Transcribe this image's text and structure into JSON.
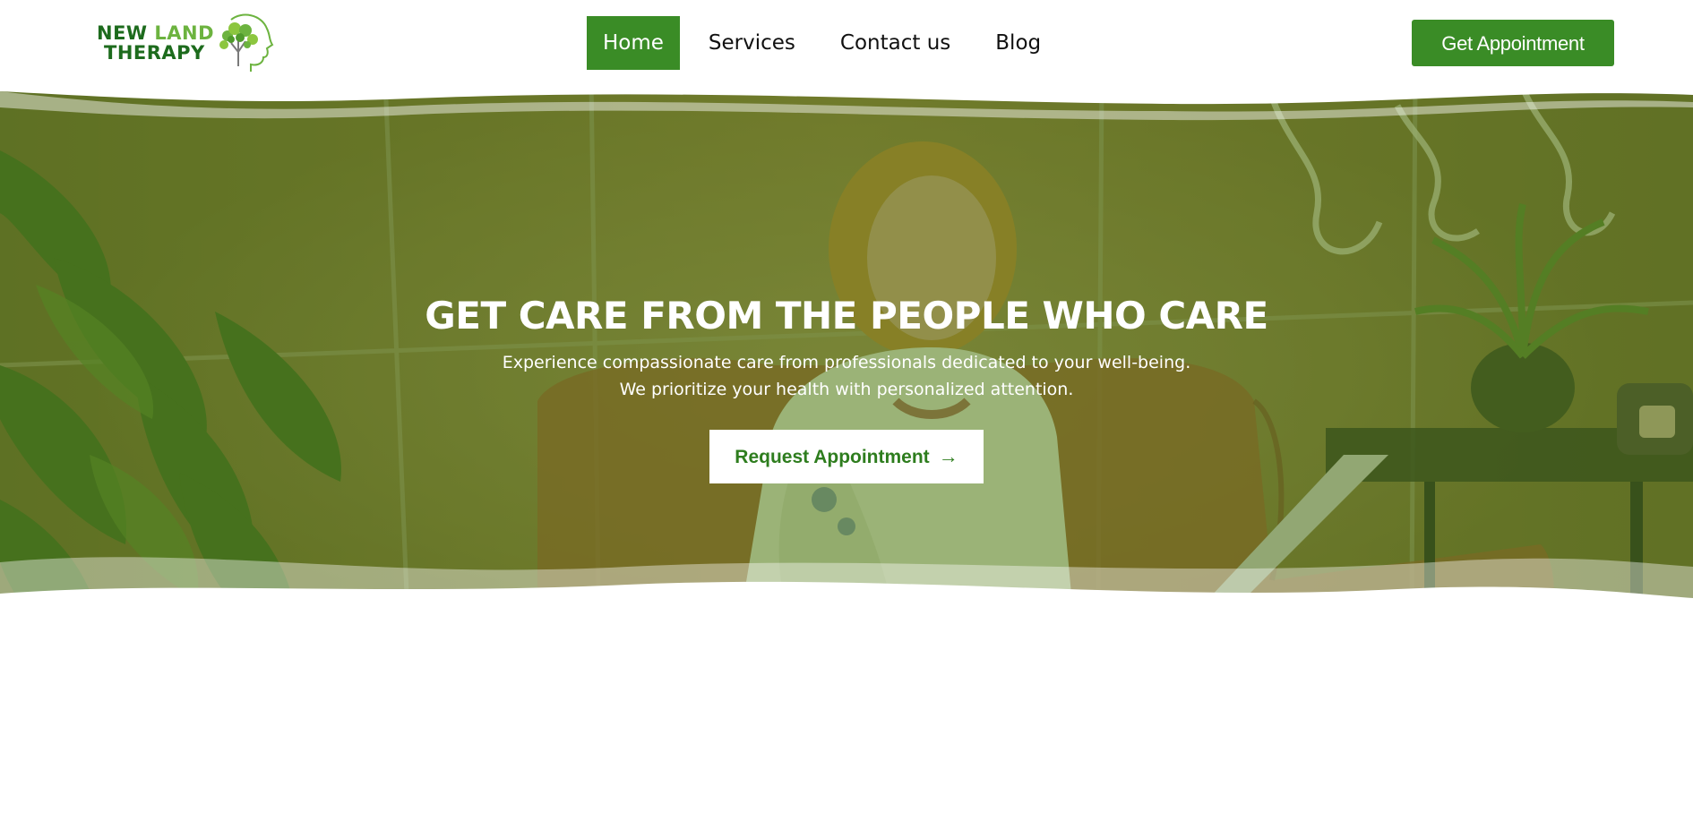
{
  "brand": {
    "line1_a": "NEW",
    "line1_b": "LAND",
    "line2": "THERAPY",
    "logo_icon": "tree-head-icon"
  },
  "nav": {
    "items": [
      {
        "label": "Home",
        "active": true
      },
      {
        "label": "Services",
        "active": false
      },
      {
        "label": "Contact us",
        "active": false
      },
      {
        "label": "Blog",
        "active": false
      }
    ]
  },
  "header": {
    "cta_label": "Get Appointment"
  },
  "hero": {
    "title": "GET CARE FROM THE PEOPLE WHO CARE",
    "subtitle": "Experience compassionate care from professionals dedicated to your well-being. We prioritize your health with personalized attention.",
    "button_label": "Request Appointment",
    "button_icon": "arrow-right-icon"
  },
  "colors": {
    "primary": "#3a8c26",
    "dark_green": "#1d6b1d",
    "light_green": "#6cb33f",
    "overlay": "#4f7a1c"
  }
}
